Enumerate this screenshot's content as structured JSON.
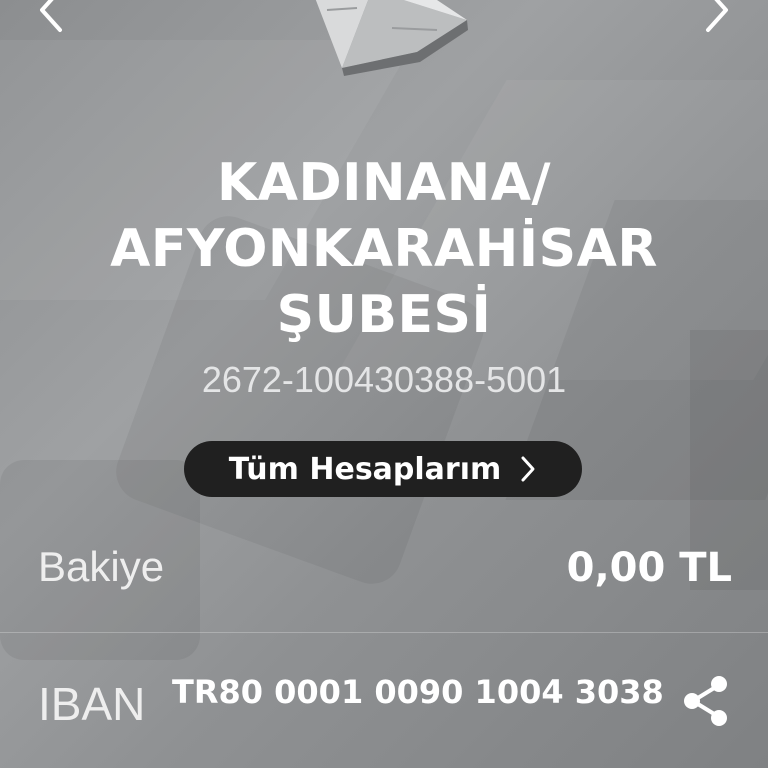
{
  "header": {
    "prev_icon": "chevron-left-icon",
    "next_icon": "chevron-right-icon",
    "card_icon": "bank-card-brochure-icon"
  },
  "account": {
    "branch_line1": "KADINANA/",
    "branch_line2": "AFYONKARAHİSAR",
    "branch_line3": "ŞUBESİ",
    "number": "2672-100430388-5001"
  },
  "all_accounts_button": {
    "label": "Tüm Hesaplarım",
    "icon": "chevron-right-icon"
  },
  "balance": {
    "label": "Bakiye",
    "value": "0,00 TL"
  },
  "iban": {
    "label": "IBAN",
    "value": "TR80 0001 0090 1004 3038",
    "share_icon": "share-icon"
  },
  "colors": {
    "background": "#929496",
    "button_bg": "#202020",
    "text": "#ffffff"
  }
}
